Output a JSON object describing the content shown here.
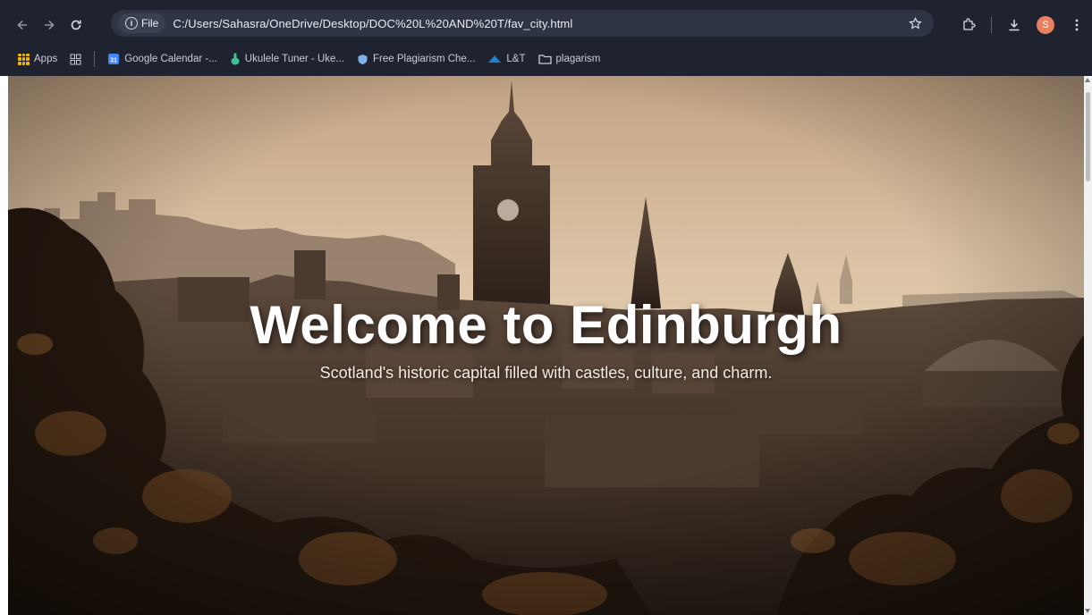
{
  "browser": {
    "site_chip": "File",
    "url": "C:/Users/Sahasra/OneDrive/Desktop/DOC%20L%20AND%20T/fav_city.html",
    "avatar_initial": "S",
    "bookmarks": [
      {
        "label": "Apps",
        "icon": "apps-icon"
      },
      {
        "label": "Google Calendar -...",
        "icon": "calendar-icon"
      },
      {
        "label": "Ukulele Tuner - Uke...",
        "icon": "ukulele-icon"
      },
      {
        "label": "Free Plagiarism Che...",
        "icon": "shield-icon"
      },
      {
        "label": "L&T",
        "icon": "lt-logo-icon"
      },
      {
        "label": "plagarism",
        "icon": "folder-icon"
      }
    ]
  },
  "hero": {
    "title": "Welcome to Edinburgh",
    "subtitle": "Scotland's historic capital filled with castles, culture, and charm."
  },
  "colors": {
    "browser_frame": "#1f2330",
    "omnibox": "#2f3444",
    "hero_title": "#ffffff",
    "sky_top": "#c9ab8c",
    "sky_bottom": "#e6cfb1"
  }
}
